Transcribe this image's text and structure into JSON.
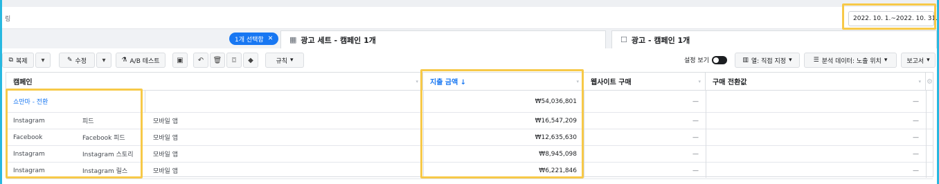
{
  "filter": {
    "partial_text": "링"
  },
  "date_range": {
    "value": "2022. 10. 1.~2022. 10. 31."
  },
  "selection": {
    "pill_label": "1개 선택함",
    "close_icon": "close-icon"
  },
  "tabs": [
    {
      "label": "광고 세트 - 캠페인 1개",
      "icon": "grid-icon"
    },
    {
      "label": "광고 - 캠페인 1개",
      "icon": "window-icon"
    }
  ],
  "toolbar": {
    "duplicate": "복제",
    "edit": "수정",
    "ab_test": "A/B 테스트",
    "rules": "규칙",
    "view_setup": "설정 보기",
    "columns": "열: 직접 지정",
    "breakdown": "분석 데이터: 노출 위치",
    "reports": "보고서"
  },
  "table": {
    "headers": {
      "campaign": "캠페인",
      "spend": "지출 금액 ↓",
      "website_purchases": "웹사이트 구매",
      "purchase_value": "구매 전환값"
    },
    "total_row": {
      "name": "쇼만마 - 전환",
      "spend": "₩54,036,801",
      "website_purchases": "—",
      "purchase_value": "—"
    },
    "rows": [
      {
        "platform": "Instagram",
        "placement": "피드",
        "device": "모바일 앱",
        "spend": "₩16,547,209",
        "website_purchases": "—",
        "purchase_value": "—"
      },
      {
        "platform": "Facebook",
        "placement": "Facebook 피드",
        "device": "모바일 앱",
        "spend": "₩12,635,630",
        "website_purchases": "—",
        "purchase_value": "—"
      },
      {
        "platform": "Instagram",
        "placement": "Instagram 스토리",
        "device": "모바일 앱",
        "spend": "₩8,945,098",
        "website_purchases": "—",
        "purchase_value": "—"
      },
      {
        "platform": "Instagram",
        "placement": "Instagram 릴스",
        "device": "모바일 앱",
        "spend": "₩6,221,846",
        "website_purchases": "—",
        "purchase_value": "—"
      }
    ]
  },
  "colors": {
    "accent": "#1877f2",
    "highlight": "#f7c948",
    "frame": "#27b8e0"
  }
}
